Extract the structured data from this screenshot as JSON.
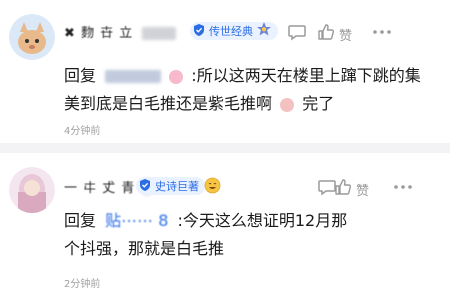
{
  "comment1": {
    "username": "✖︎ 䴯 卋 立",
    "badge": "传世经典",
    "like_label": "赞",
    "reply_prefix": "回复",
    "reply_text_1": ":所以这两天在楼里上蹿下跳的集",
    "reply_text_2a": "美到底是白毛推还是紫毛推啊",
    "reply_text_2b": "完了",
    "timestamp": "4分钟前"
  },
  "comment2": {
    "username": "一  㐄 𠀋 青",
    "badge": "史诗巨著",
    "like_label": "赞",
    "reply_prefix": "回复",
    "reply_mention": "贴⋯⋯ 8",
    "reply_text_1": ":今天这么想证明12月那",
    "reply_text_2": "个抖强，那就是白毛推",
    "timestamp": "2分钟前"
  },
  "colors": {
    "accent": "#2b6de5",
    "muted": "#9a9a9a",
    "divider": "#f3f3f5"
  }
}
